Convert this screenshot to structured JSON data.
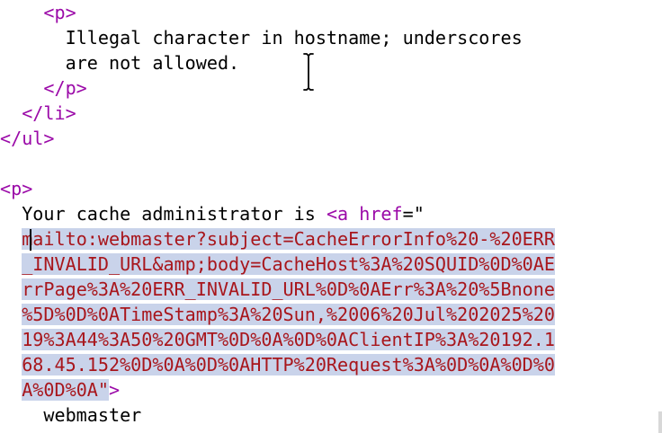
{
  "editor": {
    "lines": [
      {
        "prefix": "    ",
        "tag": "<p>"
      },
      {
        "prefix": "      ",
        "text": "Illegal character in hostname; underscores"
      },
      {
        "prefix": "      ",
        "text": "are not allowed."
      },
      {
        "prefix": "    ",
        "tag": "</p>"
      },
      {
        "prefix": "  ",
        "tag": "</li>"
      },
      {
        "prefix": "",
        "tag": "</ul>"
      },
      {
        "prefix": "",
        "tag": "<p>"
      },
      {
        "prefix": "  ",
        "text": "Your cache administrator is ",
        "tag_open": "<a ",
        "attr_name": "href",
        "attr_eq": "=\""
      },
      {
        "prefix": "  ",
        "selected": "mailto:webmaster?subject=CacheErrorInfo%20-%20ERR"
      },
      {
        "prefix": "  ",
        "selected": "_INVALID_URL&amp;body=CacheHost%3A%20SQUID%0D%0AE"
      },
      {
        "prefix": "  ",
        "selected": "rrPage%3A%20ERR_INVALID_URL%0D%0AErr%3A%20%5Bnone"
      },
      {
        "prefix": "  ",
        "selected": "%5D%0D%0ATimeStamp%3A%20Sun,%2006%20Jul%202025%20"
      },
      {
        "prefix": "  ",
        "selected": "19%3A44%3A50%20GMT%0D%0A%0D%0AClientIP%3A%20192.1"
      },
      {
        "prefix": "  ",
        "selected": "68.45.152%0D%0A%0D%0AHTTP%20Request%3A%0D%0A%0D%0"
      },
      {
        "prefix": "  ",
        "selected": "A%0D%0A\"",
        "after": ">"
      },
      {
        "prefix": "    ",
        "text": "webmaster"
      }
    ]
  },
  "colors": {
    "tag": "#9b0aa8",
    "selection_bg": "#c9d3ea",
    "selection_text": "#a8161c"
  },
  "icons": {
    "cursor": "text-cursor-icon"
  }
}
